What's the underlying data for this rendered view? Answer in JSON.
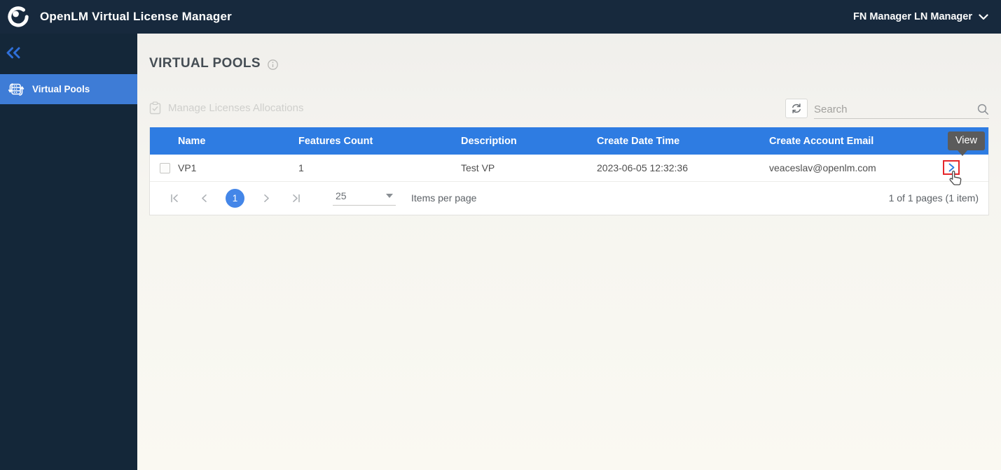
{
  "topbar": {
    "app_title": "OpenLM Virtual License Manager",
    "user_menu_label": "FN Manager LN Manager"
  },
  "sidebar": {
    "items": [
      {
        "label": "Virtual Pools",
        "active": true
      }
    ]
  },
  "page": {
    "title": "VIRTUAL POOLS"
  },
  "toolbar": {
    "manage_licenses_label": "Manage Licenses Allocations",
    "manage_licenses_enabled": false,
    "search_placeholder": "Search",
    "search_value": ""
  },
  "table": {
    "columns": [
      "Name",
      "Features Count",
      "Description",
      "Create Date Time",
      "Create Account Email"
    ],
    "rows": [
      {
        "name": "VP1",
        "features_count": "1",
        "description": "Test VP",
        "create_date_time": "2023-06-05 12:32:36",
        "create_account_email": "veaceslav@openlm.com",
        "checked": false
      }
    ]
  },
  "pagination": {
    "current_page": "1",
    "items_per_page": "25",
    "items_per_page_label": "Items per page",
    "summary": "1 of 1 pages (1 item)"
  },
  "overlay": {
    "view_tooltip": "View"
  },
  "colors": {
    "topbar_bg": "#17293d",
    "sidebar_bg": "#142739",
    "sidebar_active_bg": "#3e7cd6",
    "table_header_bg": "#2e7ce2",
    "page_circle_bg": "#4486e8",
    "tooltip_bg": "#5b5b5b",
    "highlight_red": "#e5262b",
    "accent_blue": "#2e7ce2"
  }
}
